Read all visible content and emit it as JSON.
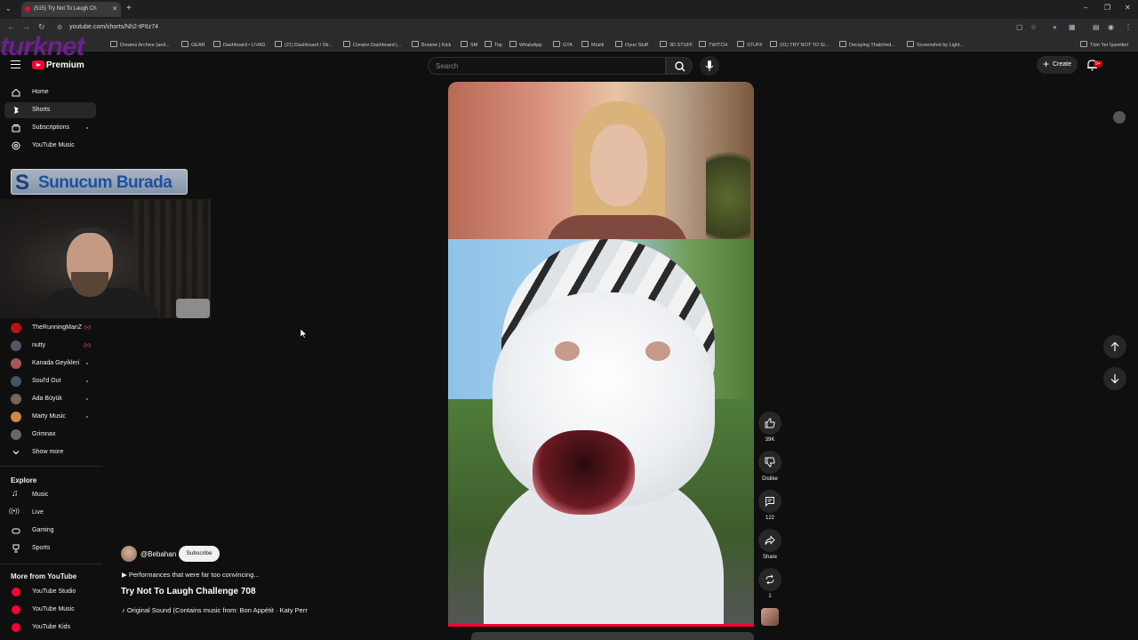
{
  "browser": {
    "tab_title": "(515) Try Not To Laugh Ch",
    "url": "youtube.com/shorts/Nh2-tPIIz74",
    "bookmarks": [
      "Dreams Archive (and...",
      "GEAR",
      "Dashboard • LIVAD",
      "(21) Dashboard / Str...",
      "Creator Dashboard |...",
      "Browse | Kick",
      "SM",
      "Top",
      "WhatsApp",
      "GTA",
      "Müzik",
      "Oyun Stuff",
      "3D STUFF",
      "TWITCH",
      "STUFF",
      "(91) TRY NOT TO SI...",
      "Decaying Thatched...",
      "Screenshot by Light..."
    ],
    "all_bookmarks": "Tüm Yer İşaretleri"
  },
  "overlay": {
    "watermark": "turknet",
    "banner_text": "Sunucum Burada",
    "banner_initial": "S"
  },
  "header": {
    "logo_label": "Premium",
    "search_placeholder": "Search",
    "create_label": "Create",
    "notif_count": "9+"
  },
  "sidebar": {
    "main": [
      {
        "label": "Home",
        "icon": "home-icon"
      },
      {
        "label": "Shorts",
        "icon": "shorts-icon",
        "active": true
      },
      {
        "label": "Subscriptions",
        "icon": "subscriptions-icon"
      },
      {
        "label": "YouTube Music",
        "icon": "music-circle-icon"
      }
    ],
    "subscriptions": [
      {
        "label": "TheRunningManZ",
        "live": true,
        "color": "#b11"
      },
      {
        "label": "nutty",
        "live": true,
        "color": "#556"
      },
      {
        "label": "Kanada Geyikleri",
        "dot": true,
        "color": "#a55"
      },
      {
        "label": "Soul'd Out",
        "dot": true,
        "color": "#456"
      },
      {
        "label": "Ada Büyük",
        "dot": true,
        "color": "#765"
      },
      {
        "label": "Marty Music",
        "dot": true,
        "color": "#c84"
      },
      {
        "label": "Grimnax",
        "dot": false,
        "color": "#666"
      }
    ],
    "show_more": "Show more",
    "explore_heading": "Explore",
    "explore": [
      "Music",
      "Live",
      "Gaming",
      "Sports"
    ],
    "more_heading": "More from YouTube",
    "more": [
      "YouTube Studio",
      "YouTube Music",
      "YouTube Kids"
    ]
  },
  "short": {
    "channel": "@Bebahan",
    "subscribe_label": "Subscribe",
    "description": "Performances that were far too convincing...",
    "title": "Try Not To Laugh Challenge 708",
    "sound": "Original Sound (Contains music from: Bon Appétit · Katy Perr",
    "progress": 1.0
  },
  "actions": {
    "likes": "39K",
    "dislike_label": "Dislike",
    "comments": "122",
    "share_label": "Share",
    "remix_count": "1"
  }
}
